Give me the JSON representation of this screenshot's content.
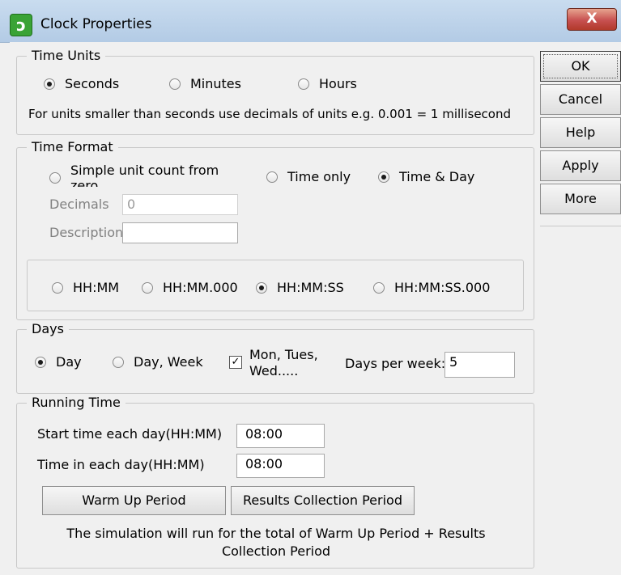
{
  "window": {
    "title": "Clock Properties",
    "close_label": "X"
  },
  "side_buttons": {
    "ok": "OK",
    "cancel": "Cancel",
    "help": "Help",
    "apply": "Apply",
    "more": "More"
  },
  "time_units": {
    "legend": "Time Units",
    "options": [
      "Seconds",
      "Minutes",
      "Hours"
    ],
    "selected": "Seconds",
    "hint": "For units smaller than seconds use decimals of units e.g. 0.001 = 1 millisecond"
  },
  "time_format": {
    "legend": "Time Format",
    "options": [
      "Simple unit count from zero",
      "Time only",
      "Time & Day"
    ],
    "selected": "Time & Day",
    "decimals_label": "Decimals",
    "decimals_value": "0",
    "description_label": "Description",
    "description_value": "",
    "clock_formats": [
      "HH:MM",
      "HH:MM.000",
      "HH:MM:SS",
      "HH:MM:SS.000"
    ],
    "clock_selected": "HH:MM:SS"
  },
  "days": {
    "legend": "Days",
    "options": [
      "Day",
      "Day, Week"
    ],
    "selected": "Day",
    "mon_tues_label": "Mon, Tues, Wed.....",
    "mon_tues_checked": true,
    "check_mark": "✓",
    "days_per_week_label": "Days per week:",
    "days_per_week_value": "5"
  },
  "running_time": {
    "legend": "Running Time",
    "start_label": "Start time each day(HH:MM)",
    "start_value": "08:00",
    "time_in_day_label": "Time in each day(HH:MM)",
    "time_in_day_value": "08:00",
    "warm_up_button": "Warm Up Period",
    "results_button": "Results Collection Period",
    "note": "The simulation will run for the total of Warm Up Period + Results Collection Period"
  },
  "colors": {
    "title_bar": "#bcd1e8",
    "close_button": "#c75050",
    "background": "#f0f0f0"
  }
}
